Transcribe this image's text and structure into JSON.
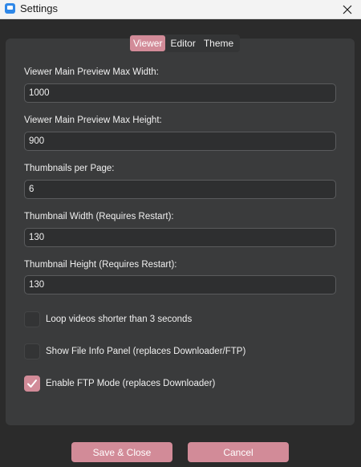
{
  "window": {
    "title": "Settings"
  },
  "tabs": [
    {
      "label": "Viewer",
      "active": true
    },
    {
      "label": "Editor",
      "active": false
    },
    {
      "label": "Theme",
      "active": false
    }
  ],
  "fields": [
    {
      "label": "Viewer Main Preview Max Width:",
      "value": "1000"
    },
    {
      "label": "Viewer Main Preview Max Height:",
      "value": "900"
    },
    {
      "label": "Thumbnails per Page:",
      "value": "6"
    },
    {
      "label": "Thumbnail Width (Requires Restart):",
      "value": "130"
    },
    {
      "label": "Thumbnail Height (Requires Restart):",
      "value": "130"
    }
  ],
  "checkboxes": [
    {
      "label": "Loop videos shorter than 3 seconds",
      "checked": false
    },
    {
      "label": "Show File Info Panel (replaces Downloader/FTP)",
      "checked": false
    },
    {
      "label": "Enable FTP Mode (replaces Downloader)",
      "checked": true
    }
  ],
  "buttons": {
    "save_close": "Save & Close",
    "cancel": "Cancel"
  },
  "colors": {
    "accent": "#d28b98",
    "panel": "#3a3b3c",
    "background": "#2b2b2b"
  },
  "icons": {
    "app": "app-icon",
    "close": "close-icon",
    "check": "checkmark-icon"
  }
}
